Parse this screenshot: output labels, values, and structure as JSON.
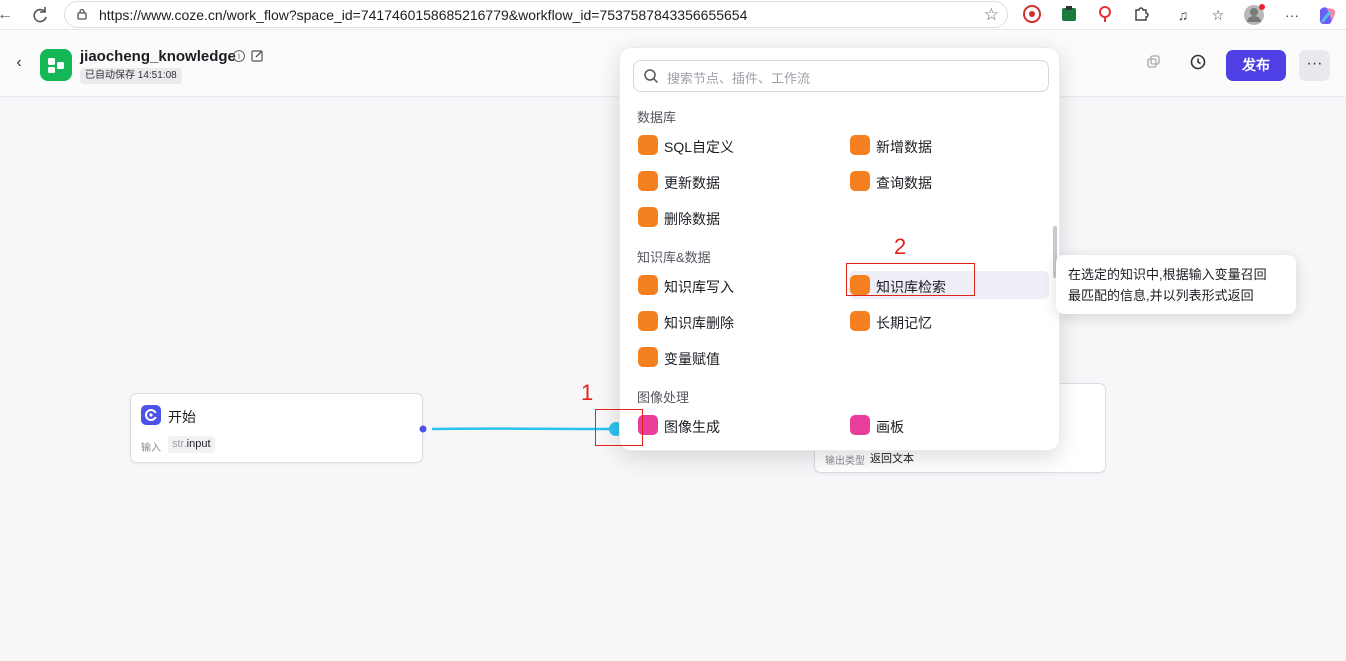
{
  "browser": {
    "url": "https://www.coze.cn/work_flow?space_id=7417460158685216779&workflow_id=7537587843356655654"
  },
  "header": {
    "workflow_name": "jiaocheng_knowledge",
    "save_status": "已自动保存 14:51:08",
    "publish_label": "发布",
    "more_label": "···"
  },
  "nodes": {
    "start": {
      "title": "开始",
      "input_label": "输入",
      "param_type": "str.",
      "param_name": "input"
    },
    "end": {
      "output_label": "输出类型",
      "output_value": "返回文本"
    }
  },
  "panel": {
    "search_placeholder": "搜索节点、插件、工作流",
    "sections": {
      "database": {
        "title": "数据库",
        "items": [
          "SQL自定义",
          "新增数据",
          "更新数据",
          "查询数据",
          "删除数据"
        ]
      },
      "knowledge": {
        "title": "知识库&数据",
        "items": [
          "知识库写入",
          "知识库检索",
          "知识库删除",
          "长期记忆",
          "变量赋值"
        ]
      },
      "image": {
        "title": "图像处理",
        "items": [
          "图像生成",
          "画板"
        ]
      }
    }
  },
  "tooltip": {
    "line1": "在选定的知识中,根据输入变量召回",
    "line2": "最匹配的信息,并以列表形式返回"
  },
  "annotations": {
    "one": "1",
    "two": "2"
  },
  "colors": {
    "accent": "#4e40e5",
    "db_icon": "#f5801f",
    "image_icon": "#e93d9e",
    "annotation": "#e2231a",
    "connector": "#2ac3f0"
  }
}
